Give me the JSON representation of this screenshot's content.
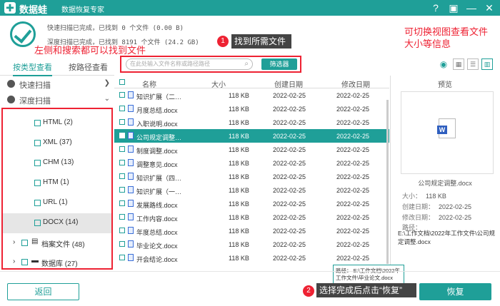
{
  "titlebar": {
    "logo": "✚",
    "app_name": "数据蛙",
    "subtitle": "数据恢复专家"
  },
  "header": {
    "quick_scan": "快速扫描已完成，已找到 0 个文件 (0.00  B)",
    "deep_scan": "深度扫描已完成，已找到 8191 个文件 (24.2 GB)"
  },
  "annotations": {
    "left": "左侧和搜索都可以找到文件",
    "find": "找到所需文件",
    "view": "可切换视图查看文件大小等信息",
    "finish": "选择完成后点击“恢复”",
    "badge1": "1",
    "badge2": "2"
  },
  "tabs": {
    "by_type": "按类型查看",
    "by_path": "按路径查看"
  },
  "sidebar": {
    "quick": "快速扫描",
    "deep": "深度扫描",
    "filetypes": [
      {
        "label": "HTML (2)"
      },
      {
        "label": "XML (37)"
      },
      {
        "label": "CHM (13)"
      },
      {
        "label": "HTM (1)"
      },
      {
        "label": "URL (1)"
      },
      {
        "label": "DOCX (14)"
      }
    ],
    "archive": "档案文件 (48)",
    "database": "数据库 (27)"
  },
  "search": {
    "placeholder": "在此处输入文件名称或路径路径",
    "filter_label": "筛选器"
  },
  "table": {
    "headers": {
      "name": "名称",
      "size": "大小",
      "created": "创建日期",
      "modified": "修改日期"
    },
    "rows": [
      {
        "name": "知识扩展（二…",
        "size": "118 KB",
        "created": "2022-02-25",
        "modified": "2022-02-25"
      },
      {
        "name": "月度总结.docx",
        "size": "118 KB",
        "created": "2022-02-25",
        "modified": "2022-02-25"
      },
      {
        "name": "入职说明.docx",
        "size": "118 KB",
        "created": "2022-02-25",
        "modified": "2022-02-25"
      },
      {
        "name": "公司规定调整…",
        "size": "118 KB",
        "created": "2022-02-25",
        "modified": "2022-02-25"
      },
      {
        "name": "制度调整.docx",
        "size": "118 KB",
        "created": "2022-02-25",
        "modified": "2022-02-25"
      },
      {
        "name": "调整意见.docx",
        "size": "118 KB",
        "created": "2022-02-25",
        "modified": "2022-02-25"
      },
      {
        "name": "知识扩展（四…",
        "size": "118 KB",
        "created": "2022-02-25",
        "modified": "2022-02-25"
      },
      {
        "name": "知识扩展（一…",
        "size": "118 KB",
        "created": "2022-02-25",
        "modified": "2022-02-25"
      },
      {
        "name": "发展路线.docx",
        "size": "118 KB",
        "created": "2022-02-25",
        "modified": "2022-02-25"
      },
      {
        "name": "工作内容.docx",
        "size": "118 KB",
        "created": "2022-02-25",
        "modified": "2022-02-25"
      },
      {
        "name": "年度总结.docx",
        "size": "118 KB",
        "created": "2022-02-25",
        "modified": "2022-02-25"
      },
      {
        "name": "毕业论文.docx",
        "size": "118 KB",
        "created": "2022-02-25",
        "modified": "2022-02-25"
      },
      {
        "name": "开会结论.docx",
        "size": "118 KB",
        "created": "2022-02-25",
        "modified": "2022-02-25"
      }
    ]
  },
  "preview": {
    "title": "预览",
    "filename": "公司规定调整.docx",
    "size_label": "大小：",
    "size": "118 KB",
    "created_label": "创建日期：",
    "created": "2022-02-25",
    "modified_label": "修改日期：",
    "modified": "2022-02-25",
    "path_label": "路径：",
    "path": "E:\\工作文档\\2022年工作文件\\公司规定调整.docx"
  },
  "tooltip": "路径： E:\\工作文档\\2022年工作文件\\毕业论文.docx",
  "footer": {
    "back": "返回",
    "restore": "恢复"
  },
  "colors": {
    "accent": "#1f9f98",
    "annotation": "#e22233"
  }
}
